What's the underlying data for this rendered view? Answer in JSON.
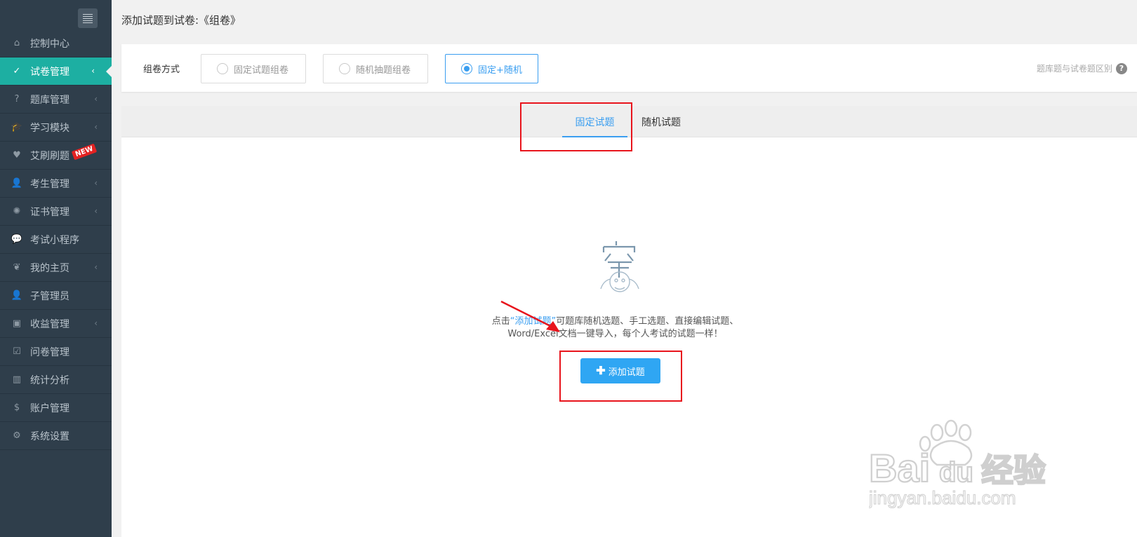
{
  "sidebar": {
    "items": [
      {
        "label": "控制中心",
        "icon": "home-icon",
        "glyph": "⌂",
        "chevron": false
      },
      {
        "label": "试卷管理",
        "icon": "check-circle-icon",
        "glyph": "✓",
        "chevron": true,
        "active": true
      },
      {
        "label": "题库管理",
        "icon": "question-circle-icon",
        "glyph": "?",
        "chevron": true
      },
      {
        "label": "学习模块",
        "icon": "graduation-cap-icon",
        "glyph": "🎓",
        "chevron": true
      },
      {
        "label": "艾刷刷题",
        "icon": "heart-icon",
        "glyph": "♥",
        "chevron": false,
        "badge": "NEW"
      },
      {
        "label": "考生管理",
        "icon": "user-icon",
        "glyph": "👤",
        "chevron": true
      },
      {
        "label": "证书管理",
        "icon": "certificate-icon",
        "glyph": "✺",
        "chevron": true
      },
      {
        "label": "考试小程序",
        "icon": "wechat-icon",
        "glyph": "💬",
        "chevron": false
      },
      {
        "label": "我的主页",
        "icon": "leaf-icon",
        "glyph": "❦",
        "chevron": true
      },
      {
        "label": "子管理员",
        "icon": "user-secret-icon",
        "glyph": "👤",
        "chevron": false
      },
      {
        "label": "收益管理",
        "icon": "money-icon",
        "glyph": "▣",
        "chevron": true
      },
      {
        "label": "问卷管理",
        "icon": "check-square-icon",
        "glyph": "☑",
        "chevron": false
      },
      {
        "label": "统计分析",
        "icon": "bar-chart-icon",
        "glyph": "▥",
        "chevron": false
      },
      {
        "label": "账户管理",
        "icon": "dollar-icon",
        "glyph": "$",
        "chevron": false
      },
      {
        "label": "系统设置",
        "icon": "gear-icon",
        "glyph": "⚙",
        "chevron": false
      }
    ]
  },
  "header": {
    "title": "添加试题到试卷:《组卷》"
  },
  "mode": {
    "label": "组卷方式",
    "options": [
      {
        "label": "固定试题组卷",
        "selected": false
      },
      {
        "label": "随机抽题组卷",
        "selected": false
      },
      {
        "label": "固定+随机",
        "selected": true
      }
    ],
    "help_text": "题库题与试卷题区别",
    "help_icon": "?"
  },
  "tabs": [
    {
      "label": "固定试题",
      "active": true
    },
    {
      "label": "随机试题",
      "active": false
    }
  ],
  "empty_state": {
    "line1_prefix": "点击",
    "line1_link": "“添加试题”",
    "line1_suffix": "可题库随机选题、手工选题、直接编辑试题、",
    "line2": "Word/Excel文档一键导入，每个人考试的试题一样！",
    "button_label": "添加试题"
  },
  "watermark": {
    "brand": "Bai",
    "brand_suffix": "du",
    "product": "经验",
    "url": "jingyan.baidu.com"
  },
  "colors": {
    "sidebar_bg": "#2f3e4b",
    "active_item": "#1dafa2",
    "accent_blue": "#3a9ef0",
    "button_blue": "#2fa6f3",
    "highlight_red": "#e8141c"
  }
}
